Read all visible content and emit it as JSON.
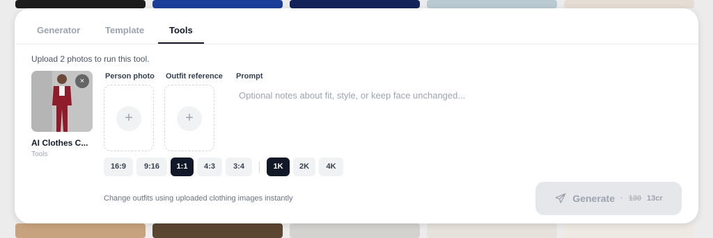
{
  "tabs": [
    {
      "label": "Generator",
      "active": false
    },
    {
      "label": "Template",
      "active": false
    },
    {
      "label": "Tools",
      "active": true
    }
  ],
  "hint": "Upload 2 photos to run this tool.",
  "tool": {
    "name": "AI Clothes C...",
    "subtitle": "Tools",
    "remove_symbol": "×"
  },
  "fields": {
    "person_label": "Person photo",
    "outfit_label": "Outfit reference",
    "prompt_label": "Prompt",
    "prompt_placeholder": "Optional notes about fit, style, or keep face unchanged...",
    "prompt_value": "",
    "plus_symbol": "+"
  },
  "aspect_ratios": [
    "16:9",
    "9:16",
    "1:1",
    "4:3",
    "3:4"
  ],
  "aspect_selected": "1:1",
  "resolutions": [
    "1K",
    "2K",
    "4K"
  ],
  "resolution_selected": "1K",
  "footer_note": "Change outfits using uploaded clothing images instantly",
  "generate": {
    "label": "Generate",
    "separator": "·",
    "old_price": "130",
    "price": "13cr"
  },
  "colors": {
    "accent": "#111827",
    "muted": "#9ca3af",
    "chip_bg": "#f1f2f4",
    "button_disabled": "#e5e7eb"
  }
}
